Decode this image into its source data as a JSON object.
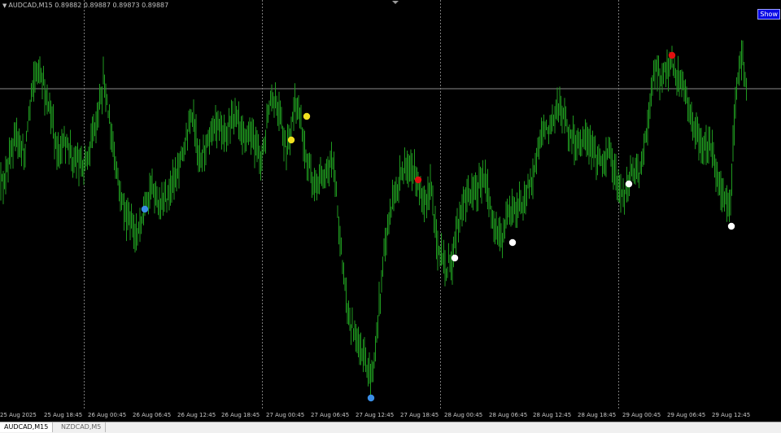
{
  "chart": {
    "info_line": "AUDCAD,M15  0.89882 0.89887 0.89873 0.89887",
    "show_button_label": "Show",
    "time_labels": [
      "25 Aug 2025",
      "25 Aug 18:45",
      "26 Aug 00:45",
      "26 Aug 06:45",
      "26 Aug 12:45",
      "26 Aug 18:45",
      "27 Aug 00:45",
      "27 Aug 06:45",
      "27 Aug 12:45",
      "27 Aug 18:45",
      "28 Aug 00:45",
      "28 Aug 06:45",
      "28 Aug 12:45",
      "28 Aug 18:45",
      "29 Aug 00:45",
      "29 Aug 06:45",
      "29 Aug 12:45"
    ],
    "colors": {
      "background": "#000000",
      "bars": "#1f9a1f",
      "grid": "#7a7a7a",
      "signal_blue": "#3a8ee6",
      "signal_yellow": "#f0e020",
      "signal_red": "#e01010",
      "signal_white": "#ffffff"
    },
    "signal_markers": [
      "blue",
      "yellow",
      "yellow",
      "blue",
      "red",
      "white",
      "white",
      "white",
      "red",
      "white"
    ]
  },
  "tabs": [
    {
      "label": "AUDCAD,M15",
      "active": true
    },
    {
      "label": "NZDCAD,M5",
      "active": false
    }
  ]
}
